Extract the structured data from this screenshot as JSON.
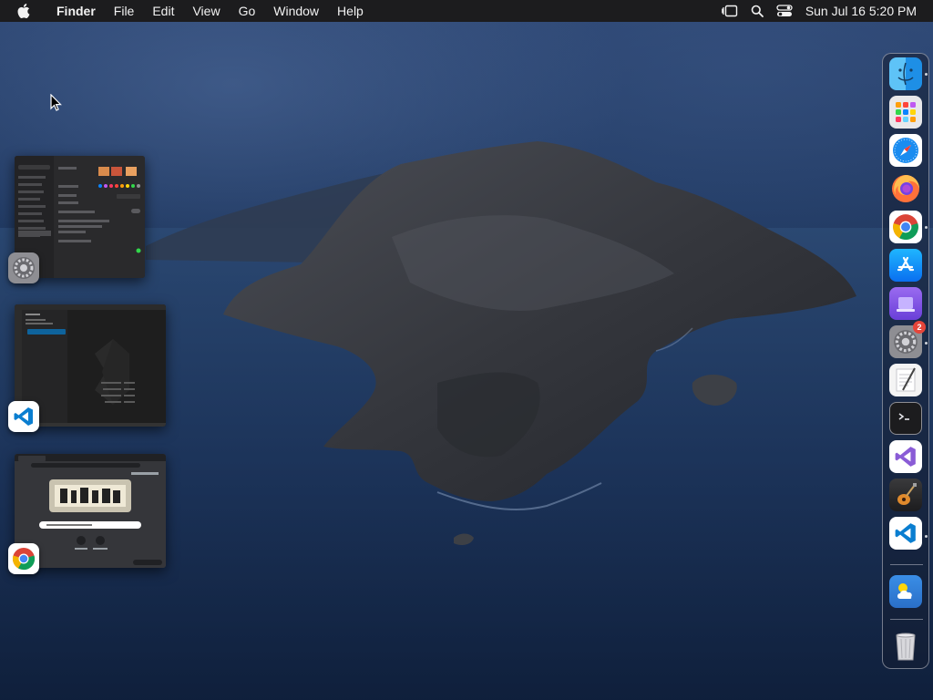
{
  "menubar": {
    "app_name": "Finder",
    "menus": [
      "File",
      "Edit",
      "View",
      "Go",
      "Window",
      "Help"
    ],
    "clock": "Sun Jul 16  5:20 PM"
  },
  "windows": [
    {
      "app": "System Settings",
      "icon": "settings-gear-icon"
    },
    {
      "app": "Visual Studio Code",
      "icon": "vscode-icon"
    },
    {
      "app": "Google Chrome",
      "icon": "chrome-icon"
    }
  ],
  "dock": {
    "items": [
      {
        "name": "Finder",
        "icon": "finder-icon",
        "running": true
      },
      {
        "name": "Launchpad",
        "icon": "launchpad-icon",
        "running": false
      },
      {
        "name": "Safari",
        "icon": "safari-icon",
        "running": false
      },
      {
        "name": "Firefox",
        "icon": "firefox-icon",
        "running": false
      },
      {
        "name": "Google Chrome",
        "icon": "chrome-icon",
        "running": true
      },
      {
        "name": "App Store",
        "icon": "app-store-icon",
        "running": false
      },
      {
        "name": "Simulator",
        "icon": "simulator-icon",
        "running": false
      },
      {
        "name": "System Settings",
        "icon": "settings-gear-icon",
        "running": true,
        "badge": "2"
      },
      {
        "name": "TextEdit",
        "icon": "textedit-icon",
        "running": false
      },
      {
        "name": "Terminal",
        "icon": "terminal-icon",
        "running": false
      },
      {
        "name": "Visual Studio",
        "icon": "visual-studio-icon",
        "running": false
      },
      {
        "name": "GarageBand",
        "icon": "garageband-icon",
        "running": false
      },
      {
        "name": "Visual Studio Code",
        "icon": "vscode-icon",
        "running": true
      },
      {
        "name": "Weather",
        "icon": "weather-icon",
        "running": false
      },
      {
        "name": "Trash",
        "icon": "trash-icon",
        "running": false
      }
    ]
  },
  "colors": {
    "menubar_bg": "#1c1c1e",
    "accent_blue": "#0a84ff",
    "badge_red": "#e5453a"
  }
}
